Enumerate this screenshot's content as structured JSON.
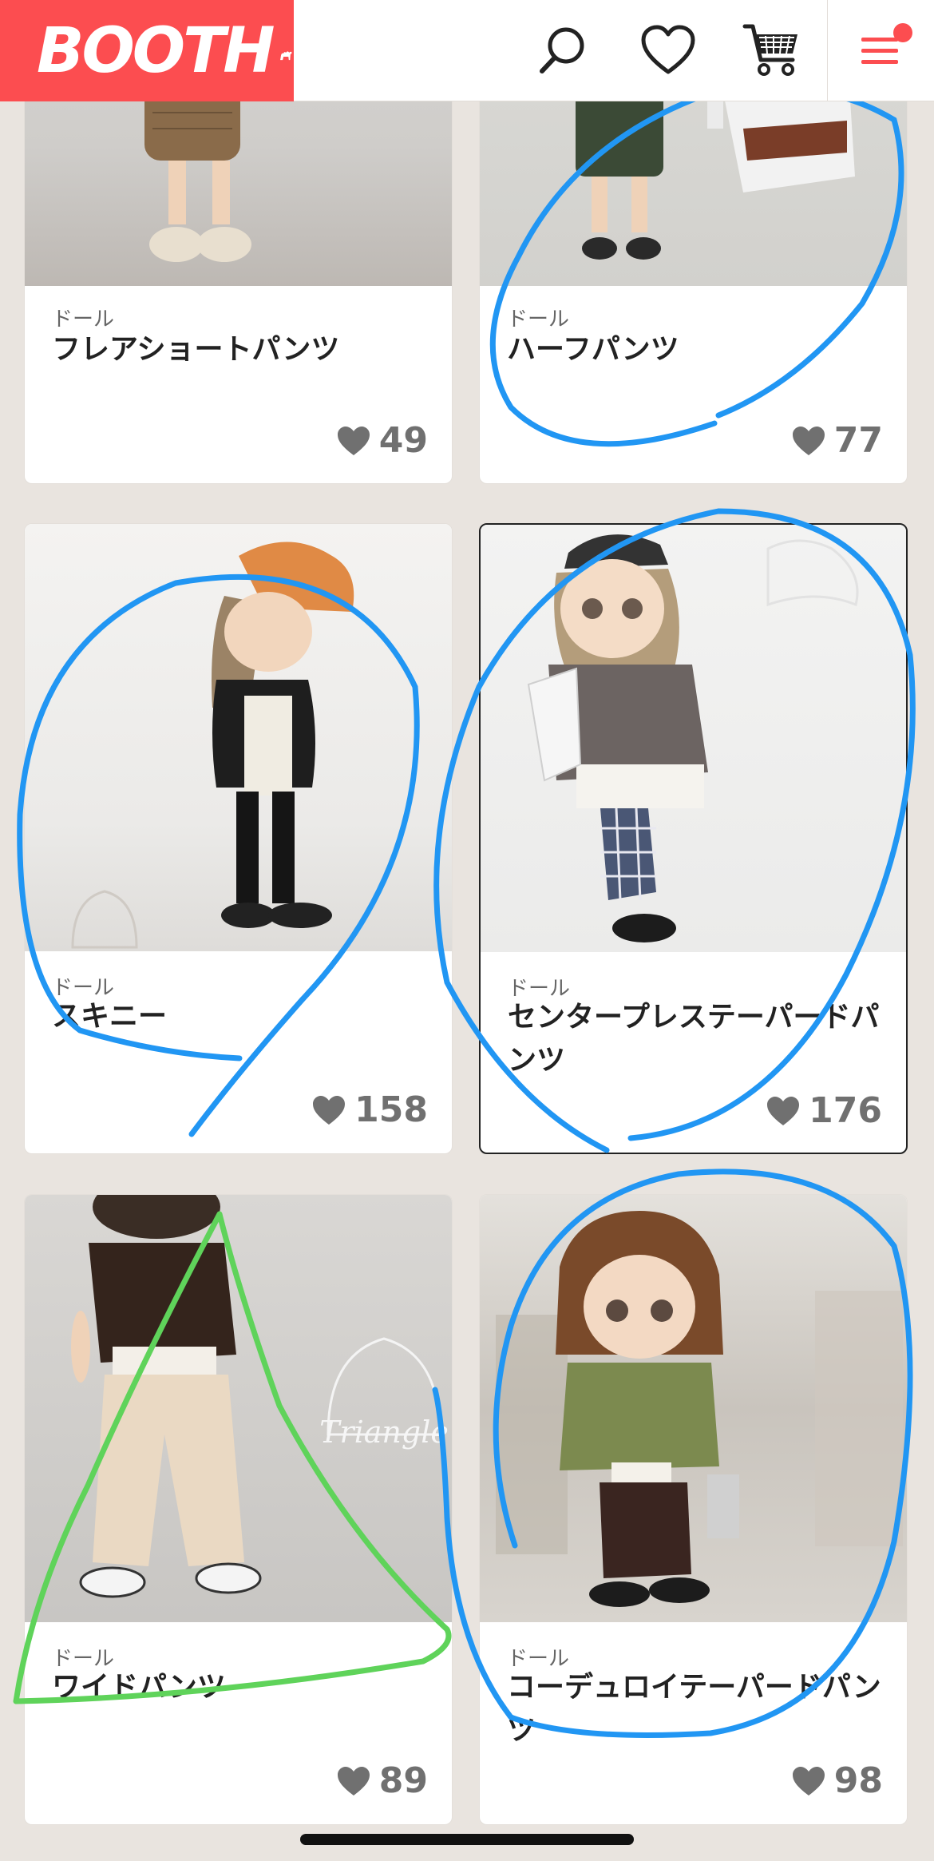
{
  "header": {
    "logo_text": "BOOTH",
    "icons": [
      "search-icon",
      "heart-icon",
      "cart-icon",
      "menu-icon"
    ],
    "brand_color": "#fc4d50"
  },
  "products": [
    {
      "category": "ドール",
      "name": "フレアショートパンツ",
      "likes": "49"
    },
    {
      "category": "ドール",
      "name": "ハーフパンツ",
      "likes": "77"
    },
    {
      "category": "ドール",
      "name": "スキニー",
      "likes": "158"
    },
    {
      "category": "ドール",
      "name": "センタープレステーパードパンツ",
      "likes": "176"
    },
    {
      "category": "ドール",
      "name": "ワイドパンツ",
      "likes": "89"
    },
    {
      "category": "ドール",
      "name": "コーデュロイテーパードパンツ",
      "likes": "98"
    }
  ],
  "watermark": "Triangle",
  "annotation_colors": {
    "circle": "#2196f3",
    "triangle": "#5fd35a"
  }
}
